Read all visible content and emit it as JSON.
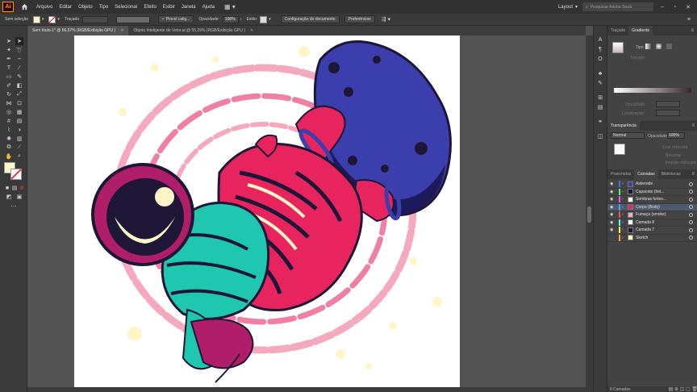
{
  "menu": {
    "logo": "Ai",
    "items": [
      "Arquivo",
      "Editar",
      "Objeto",
      "Tipo",
      "Selecionar",
      "Efeito",
      "Exibir",
      "Janela",
      "Ajuda"
    ],
    "workspace": "Layout",
    "search_placeholder": "Pesquisar Adobe Stock"
  },
  "control": {
    "selection": "Sem seleção",
    "stroke_label": "Traçado",
    "brush": "Pincel calig...",
    "opacity_label": "Opacidade:",
    "opacity_value": "100%",
    "style_label": "Estilo:",
    "doc_setup": "Configuração do documento",
    "preferences": "Preferências"
  },
  "tabs": [
    {
      "label": "Sem título-1* @ 66,67% (RGB/Exibição GPU )",
      "active": true
    },
    {
      "label": "Objeto Inteligente de Vetor.ai @ 55,29% (RGB/Exibição GPU )",
      "active": false
    }
  ],
  "panels": {
    "top_tabs": [
      "Traçado",
      "Gradiente"
    ],
    "gradient_type_label": "Tipo:",
    "traced_label": "Traçado:",
    "opacity_label": "Opacidade:",
    "location_label": "Localização:",
    "transparency_tab": "Transparência",
    "blend_mode": "Normal",
    "transp_opacity_label": "Opacidade:",
    "transp_opacity_value": "100%",
    "create_mask": "Criar máscara",
    "clip": "Recortar",
    "invert_mask": "Inverter máscara",
    "layer_tabs": [
      "Pranchetas",
      "Camadas",
      "Bibliotecas"
    ],
    "layers": [
      {
        "name": "Asteroide",
        "color": "#4f6bff",
        "selected": false
      },
      {
        "name": "Capacete (hel...",
        "color": "#4fff4f",
        "selected": false
      },
      {
        "name": "Sombras fortes...",
        "color": "#ff4fff",
        "selected": false
      },
      {
        "name": "Corpo (Body)",
        "color": "#4f9fff",
        "selected": true
      },
      {
        "name": "Fumaça (smoke)",
        "color": "#ff4f4f",
        "selected": false
      },
      {
        "name": "Camada 8",
        "color": "#4fffff",
        "selected": false
      },
      {
        "name": "Camada 7",
        "color": "#ffff4f",
        "selected": false
      },
      {
        "name": "Sketch",
        "color": "#ff9f4f",
        "selected": false
      }
    ],
    "layers_count": "8 Camadas"
  },
  "colors": {
    "fill": "#fff6c8",
    "asteroid": "#3b3fae",
    "asteroid_dark": "#1c1a5a",
    "pink": "#e8245f",
    "teal": "#1fc6b0",
    "smoke": "#f5a9bf",
    "outline": "#1e1636"
  }
}
